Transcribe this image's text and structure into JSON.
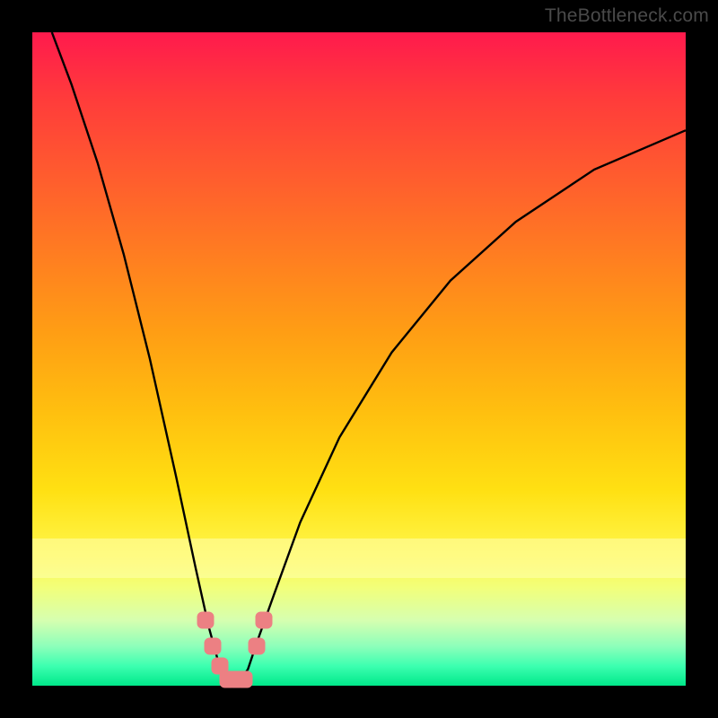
{
  "watermark": "TheBottleneck.com",
  "colors": {
    "frame": "#000000",
    "dot": "#ec8083",
    "curve": "#000000",
    "gradient_top": "#ff1a4d",
    "gradient_bottom": "#00e88a"
  },
  "chart_data": {
    "type": "line",
    "title": "",
    "xlabel": "",
    "ylabel": "",
    "xlim": [
      0,
      100
    ],
    "ylim": [
      0,
      100
    ],
    "notes": "Background is a red→green vertical gradient (high bottleneck = red at top, low = green at bottom). Black curve is a V whose minimum touches y≈0. Pink dots cluster near the minimum.",
    "curve": [
      {
        "x": 3.0,
        "y": 100.0
      },
      {
        "x": 6.0,
        "y": 92.0
      },
      {
        "x": 10.0,
        "y": 80.0
      },
      {
        "x": 14.0,
        "y": 66.0
      },
      {
        "x": 18.0,
        "y": 50.0
      },
      {
        "x": 22.0,
        "y": 32.0
      },
      {
        "x": 25.0,
        "y": 18.0
      },
      {
        "x": 27.0,
        "y": 9.0
      },
      {
        "x": 28.5,
        "y": 3.5
      },
      {
        "x": 30.0,
        "y": 0.5
      },
      {
        "x": 31.5,
        "y": 0.5
      },
      {
        "x": 33.0,
        "y": 2.5
      },
      {
        "x": 34.5,
        "y": 7.0
      },
      {
        "x": 37.0,
        "y": 14.0
      },
      {
        "x": 41.0,
        "y": 25.0
      },
      {
        "x": 47.0,
        "y": 38.0
      },
      {
        "x": 55.0,
        "y": 51.0
      },
      {
        "x": 64.0,
        "y": 62.0
      },
      {
        "x": 74.0,
        "y": 71.0
      },
      {
        "x": 86.0,
        "y": 79.0
      },
      {
        "x": 100.0,
        "y": 85.0
      }
    ],
    "dots": [
      {
        "x": 26.5,
        "y": 10.0
      },
      {
        "x": 27.6,
        "y": 6.0
      },
      {
        "x": 28.7,
        "y": 3.0
      },
      {
        "x": 30.0,
        "y": 1.0
      },
      {
        "x": 31.2,
        "y": 1.0
      },
      {
        "x": 32.4,
        "y": 1.0
      },
      {
        "x": 34.4,
        "y": 6.0
      },
      {
        "x": 35.4,
        "y": 10.0
      }
    ]
  }
}
